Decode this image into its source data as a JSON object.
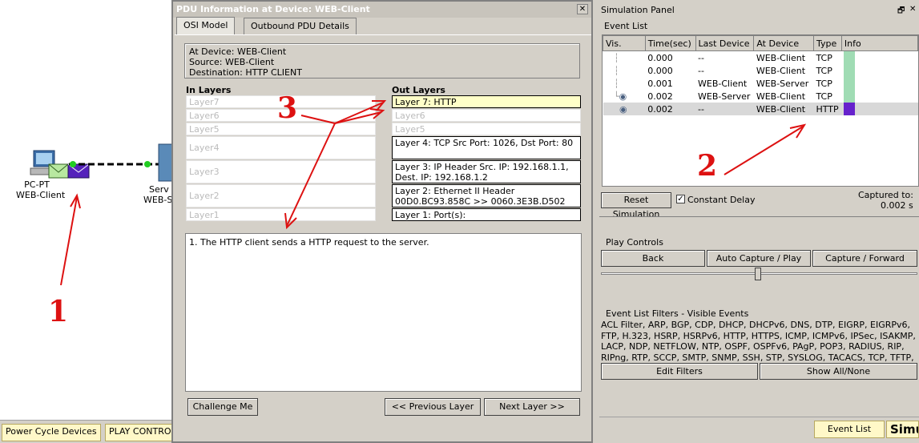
{
  "workspace": {
    "pc_label_type": "PC-PT",
    "pc_label_name": "WEB-Client",
    "server_label_type": "Serv",
    "server_label_name": "WEB-S"
  },
  "bottom_bar": {
    "power_cycle": "Power Cycle Devices",
    "play_control": "PLAY CONTRO"
  },
  "pdu_window": {
    "title": "PDU Information at Device: WEB-Client",
    "close_glyph": "✕",
    "tabs": [
      {
        "label": "OSI Model"
      },
      {
        "label": "Outbound PDU Details"
      }
    ],
    "info": {
      "at_device": "At Device: WEB-Client",
      "source": "Source: WEB-Client",
      "destination": "Destination: HTTP CLIENT"
    },
    "in_layers_header": "In Layers",
    "out_layers_header": "Out Layers",
    "in_layers": [
      "Layer7",
      "Layer6",
      "Layer5",
      "Layer4",
      "Layer3",
      "Layer2",
      "Layer1"
    ],
    "out_layers": [
      "Layer 7: HTTP",
      "Layer6",
      "Layer5",
      "Layer 4: TCP Src Port: 1026, Dst Port: 80",
      "Layer 3: IP Header Src. IP: 192.168.1.1, Dest. IP: 192.168.1.2",
      "Layer 2: Ethernet II Header 00D0.BC93.858C >> 0060.3E3B.D502",
      "Layer 1: Port(s):"
    ],
    "description": "1. The HTTP client sends a HTTP request to the server.",
    "buttons": {
      "challenge": "Challenge Me",
      "previous": "<< Previous Layer",
      "next": "Next Layer >>"
    }
  },
  "simulation_panel": {
    "title": "Simulation Panel",
    "restore_glyph": "🗗",
    "close_glyph": "✕",
    "event_list_label": "Event List",
    "columns": [
      "Vis.",
      "Time(sec)",
      "Last Device",
      "At Device",
      "Type",
      "Info"
    ],
    "events": [
      {
        "time": "0.000",
        "last": "--",
        "at": "WEB-Client",
        "type": "TCP",
        "info_color": "#a0dcb4"
      },
      {
        "time": "0.000",
        "last": "--",
        "at": "WEB-Client",
        "type": "TCP",
        "info_color": "#a0dcb4"
      },
      {
        "time": "0.001",
        "last": "WEB-Client",
        "at": "WEB-Server",
        "type": "TCP",
        "info_color": "#a0dcb4"
      },
      {
        "time": "0.002",
        "last": "WEB-Server",
        "at": "WEB-Client",
        "type": "TCP",
        "info_color": "#a0dcb4"
      },
      {
        "time": "0.002",
        "last": "--",
        "at": "WEB-Client",
        "type": "HTTP",
        "info_color": "#6622cc"
      }
    ],
    "reset_button": "Reset Simulation",
    "constant_delay": "Constant Delay",
    "captured_label": "Captured to:",
    "captured_value": "0.002 s",
    "play_controls_label": "Play Controls",
    "back": "Back",
    "auto_capture": "Auto Capture / Play",
    "capture_forward": "Capture / Forward",
    "filters_label": "Event List Filters - Visible Events",
    "filters_text": "ACL Filter, ARP, BGP, CDP, DHCP, DHCPv6, DNS, DTP, EIGRP, EIGRPv6, FTP, H.323, HSRP, HSRPv6, HTTP, HTTPS, ICMP, ICMPv6, IPSec, ISAKMP, LACP, NDP, NETFLOW, NTP, OSPF, OSPFv6, PAgP, POP3, RADIUS, RIP, RIPng, RTP, SCCP, SMTP, SNMP, SSH, STP, SYSLOG, TACACS, TCP, TFTP, Telnet, UDP, VTP",
    "edit_filters": "Edit Filters",
    "show_all": "Show All/None",
    "event_list_button": "Event List",
    "sim_button": "Simu"
  },
  "annotations": {
    "n1": "1",
    "n2": "2",
    "n3": "3"
  },
  "colors": {
    "annotation_red": "#dd1111",
    "selected_layer": "#ffffc8",
    "tcp_info": "#a0dcb4",
    "http_info": "#6622cc"
  }
}
